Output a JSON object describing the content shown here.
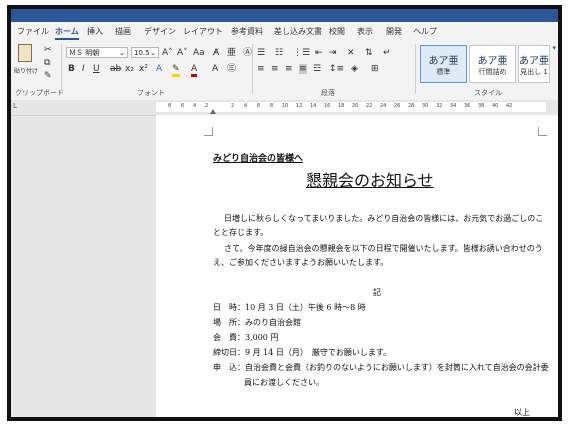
{
  "ribbon_tabs": [
    "ファイル",
    "ホーム",
    "挿入",
    "描画",
    "デザイン",
    "レイアウト",
    "参考資料",
    "差し込み文書",
    "校閲",
    "表示",
    "開発",
    "ヘルプ"
  ],
  "clipboard": {
    "paste_label": "貼り付け",
    "group_label": "クリップボード"
  },
  "font": {
    "name": "ＭＳ 明朝",
    "size": "10.5",
    "group_label": "フォント"
  },
  "paragraph": {
    "group_label": "段落"
  },
  "styles": {
    "group_label": "スタイル",
    "items": [
      {
        "preview": "あア亜",
        "label": "標準"
      },
      {
        "preview": "あア亜",
        "label": "行間詰め"
      },
      {
        "preview": "あア亜",
        "label": "見出し 1"
      }
    ]
  },
  "ruler_numbers": [
    "8",
    "6",
    "4",
    "2",
    "2",
    "4",
    "6",
    "8",
    "10",
    "12",
    "14",
    "16",
    "18",
    "20",
    "22",
    "24",
    "26",
    "28",
    "30",
    "32",
    "34",
    "36",
    "38",
    "40",
    "42"
  ],
  "document": {
    "addressee": "みどり自治会の皆様へ",
    "title": "懇親会のお知らせ",
    "para1_line1": "日増しに秋らしくなってまいりました。みどり自治会の皆様には、お元気でお過ごしのこ",
    "para1_line2": "とと存じます。",
    "para2_line1": "さて、今年度の緑自治会の懇親会を以下の日程で開催いたします。皆様お誘い合わせのう",
    "para2_line2": "え、ご参加くださいますようお願いいたします。",
    "ki": "記",
    "date": "日　時：10 月 3 日（土）午後 6 時～8 時",
    "place": "場　所：みのり自治会館",
    "fee": "会　費：3,000 円",
    "deadline": "締切日：9 月 14 日（月）　厳守でお願いします。",
    "apply_line1": "申　込：自治会費と会費（お釣りのないようにお願いします）を封筒に入れて自治会の会計委",
    "apply_line2": "員にお渡しください。",
    "closing": "以上"
  }
}
